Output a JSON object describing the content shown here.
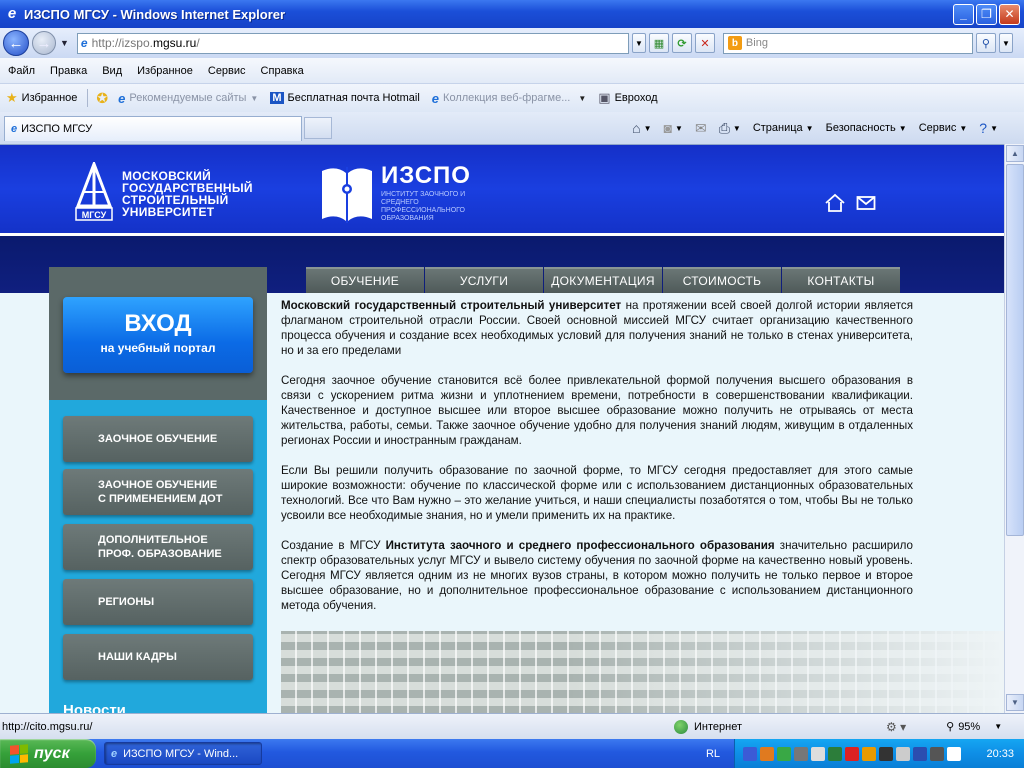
{
  "window": {
    "title": "ИЗСПО МГСУ - Windows Internet Explorer"
  },
  "addressbar": {
    "url_prefix": "http://izspo.",
    "url_domain": "mgsu.ru",
    "url_suffix": "/",
    "search_placeholder": "Bing"
  },
  "menubar": {
    "items": [
      "Файл",
      "Правка",
      "Вид",
      "Избранное",
      "Сервис",
      "Справка"
    ]
  },
  "favorites": {
    "label": "Избранное",
    "items": [
      "Рекомендуемые сайты",
      "Бесплатная почта Hotmail",
      "Коллекция веб-фрагме...",
      "Евроход"
    ]
  },
  "tab": {
    "title": "ИЗСПО МГСУ"
  },
  "commandbar": {
    "items": [
      "Страница",
      "Безопасность",
      "Сервис"
    ]
  },
  "site": {
    "university_name": [
      "МОСКОВСКИЙ",
      "ГОСУДАРСТВЕННЫЙ",
      "СТРОИТЕЛЬНЫЙ",
      "УНИВЕРСИТЕТ"
    ],
    "msgu_logo_text": "МГСУ",
    "izspo_title": "ИЗСПО",
    "izspo_subtitle": "ИНСТИТУТ ЗАОЧНОГО И СРЕДНЕГО ПРОФЕССИОНАЛЬНОГО ОБРАЗОВАНИЯ",
    "nav": [
      "ОБУЧЕНИЕ",
      "УСЛУГИ",
      "ДОКУМЕНТАЦИЯ",
      "СТОИМОСТЬ",
      "КОНТАКТЫ"
    ],
    "login": {
      "title": "ВХОД",
      "subtitle": "на учебный портал"
    },
    "side_menu": [
      [
        "ЗАОЧНОЕ ОБУЧЕНИЕ"
      ],
      [
        "ЗАОЧНОЕ ОБУЧЕНИЕ",
        "С ПРИМЕНЕНИЕМ ДОТ"
      ],
      [
        "ДОПОЛНИТЕЛЬНОЕ",
        "ПРОФ. ОБРАЗОВАНИЕ"
      ],
      [
        "РЕГИОНЫ"
      ],
      [
        "НАШИ КАДРЫ"
      ]
    ],
    "news_label": "Новости",
    "paragraphs": [
      {
        "bold_lead": "Московский государственный строительный университет",
        "text": " на протяжении всей своей долгой истории является флагманом строительной отрасли России. Своей основной миссией МГСУ считает организацию качественного процесса обучения и создание всех необходимых условий для получения знаний не только в стенах университета, но и за его пределами"
      },
      {
        "text": "Сегодня заочное обучение становится всё более привлекательной формой получения высшего образования в связи с ускорением ритма жизни и уплотнением времени, потребности в совершенствовании квалификации. Качественное и доступное высшее или второе высшее образование можно получить не отрываясь от места жительства, работы, семьи. Также заочное обучение удобно для получения знаний людям, живущим в отдаленных регионах России и иностранным гражданам."
      },
      {
        "text": "Если Вы решили получить образование по заочной форме, то МГСУ сегодня предоставляет для этого самые широкие возможности: обучение по классической форме или с использованием дистанционных образовательных технологий. Все что Вам нужно – это желание учиться, и наши специалисты позаботятся о том, чтобы Вы не только усвоили все необходимые знания, но и умели применить их на практике."
      },
      {
        "pre": "Создание в МГСУ ",
        "bold_mid": "Института заочного и среднего профессионального образования",
        "post": " значительно расширило спектр образовательных услуг МГСУ и вывело систему обучения по заочной форме на качественно новый уровень. Сегодня МГСУ является одним из не многих вузов страны, в котором можно получить не только первое и второе высшее образование, но и дополнительное профессиональное образование с использованием дистанционного метода обучения."
      }
    ]
  },
  "statusbar": {
    "url": "http://cito.mgsu.ru/",
    "zone": "Интернет",
    "zoom": "95%"
  },
  "taskbar": {
    "start": "пуск",
    "task": "ИЗСПО МГСУ - Wind...",
    "lang": "RL",
    "clock": "20:33"
  },
  "colors": {
    "header_blue": "#1a3fe0",
    "login_blue": "#0b6be6",
    "sidebar_cyan": "#21a8dc",
    "menu_gray": "#5b6968"
  }
}
